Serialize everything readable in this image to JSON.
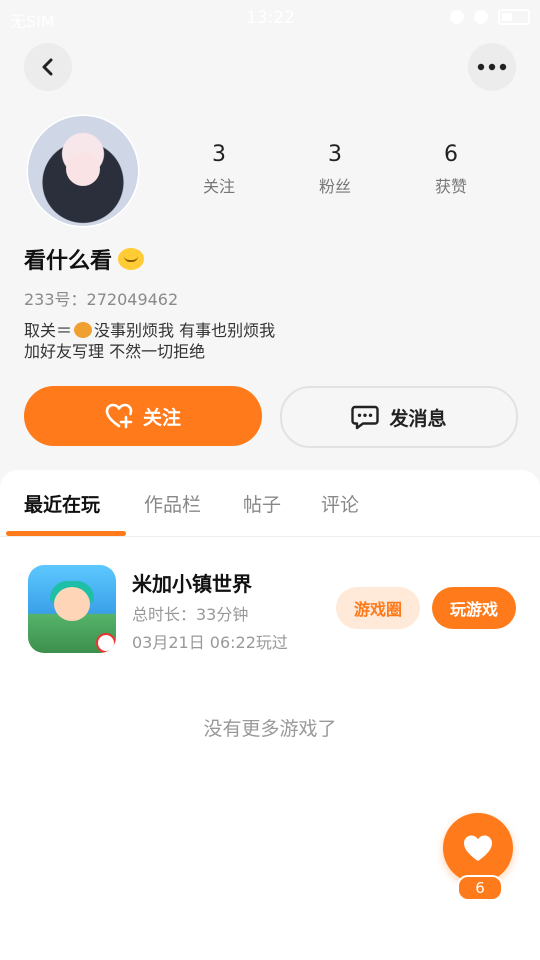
{
  "status_bar": {
    "carrier": "无SIM",
    "time": "13:22"
  },
  "profile": {
    "stats": [
      {
        "value": "3",
        "label": "关注"
      },
      {
        "value": "3",
        "label": "粉丝"
      },
      {
        "value": "6",
        "label": "获赞"
      }
    ],
    "nickname": "看什么看",
    "uid": "233号：272049462",
    "bio_line1_prefix": "取关＝",
    "bio_line1_suffix": "没事别烦我 有事也别烦我",
    "bio_line2": "加好友写理 不然一切拒绝"
  },
  "actions": {
    "follow_label": "关注",
    "message_label": "发消息"
  },
  "tabs": [
    {
      "label": "最近在玩",
      "active": true
    },
    {
      "label": "作品栏",
      "active": false
    },
    {
      "label": "帖子",
      "active": false
    },
    {
      "label": "评论",
      "active": false
    }
  ],
  "recent_game": {
    "title": "米加小镇世界",
    "duration": "总时长：33分钟",
    "last_played": "03月21日 06:22玩过",
    "circle_label": "游戏圈",
    "play_label": "玩游戏"
  },
  "footer_text": "没有更多游戏了",
  "likes": {
    "count": "6"
  },
  "colors": {
    "accent": "#ff7a1a",
    "accent_light": "#ffe9d8"
  },
  "icons": [
    "back-icon",
    "more-icon",
    "follow-heart-icon",
    "message-icon",
    "like-heart-icon"
  ]
}
